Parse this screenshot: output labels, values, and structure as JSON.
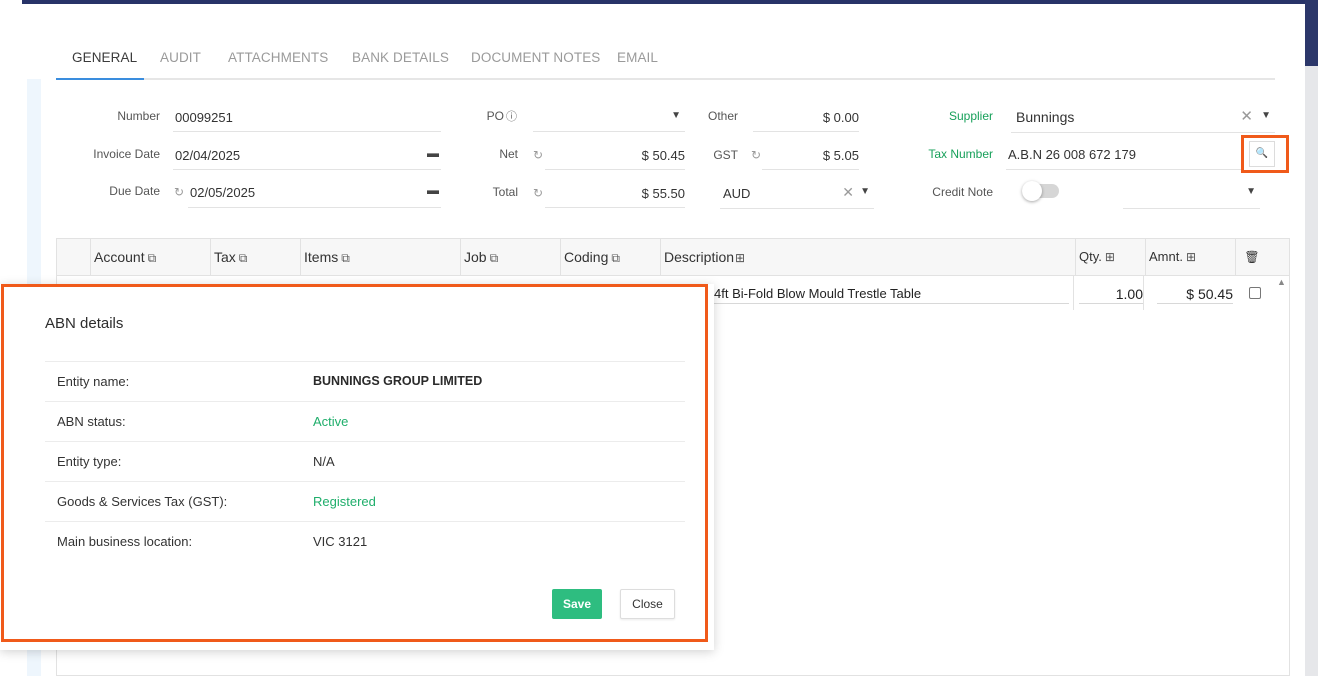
{
  "tabs": [
    {
      "label": "GENERAL"
    },
    {
      "label": "AUDIT"
    },
    {
      "label": "ATTACHMENTS"
    },
    {
      "label": "BANK DETAILS"
    },
    {
      "label": "DOCUMENT NOTES"
    },
    {
      "label": "EMAIL"
    }
  ],
  "form": {
    "number_label": "Number",
    "number_value": "00099251",
    "invoice_date_label": "Invoice Date",
    "invoice_date_value": "02/04/2025",
    "due_date_label": "Due Date",
    "due_date_value": "02/05/2025",
    "po_label": "PO",
    "net_label": "Net",
    "net_value": "$ 50.45",
    "total_label": "Total",
    "total_value": "$ 55.50",
    "other_label": "Other",
    "other_value": "$ 0.00",
    "gst_label": "GST",
    "gst_value": "$ 5.05",
    "currency_value": "AUD",
    "supplier_label": "Supplier",
    "supplier_value": "Bunnings",
    "tax_number_label": "Tax Number",
    "tax_number_value": "A.B.N 26 008 672 179",
    "credit_note_label": "Credit Note"
  },
  "grid": {
    "columns": [
      "Account",
      "Tax",
      "Items",
      "Job",
      "Coding",
      "Description",
      "Qty.",
      "Amnt."
    ],
    "row": {
      "description": "4ft Bi-Fold Blow Mould Trestle Table",
      "qty": "1.00",
      "amount": "$ 50.45"
    }
  },
  "modal": {
    "title": "ABN details",
    "rows": [
      {
        "key": "Entity name:",
        "value": "BUNNINGS GROUP LIMITED"
      },
      {
        "key": "ABN status:",
        "value": "Active"
      },
      {
        "key": "Entity type:",
        "value": "N/A"
      },
      {
        "key": "Goods & Services Tax (GST):",
        "value": "Registered"
      },
      {
        "key": "Main business location:",
        "value": "VIC 3121"
      }
    ],
    "save_label": "Save",
    "close_label": "Close"
  },
  "colors": {
    "accent_green": "#2ebd80",
    "highlight_orange": "#f05a1a",
    "tab_underline": "#3a8dde",
    "header_navy": "#283368"
  }
}
